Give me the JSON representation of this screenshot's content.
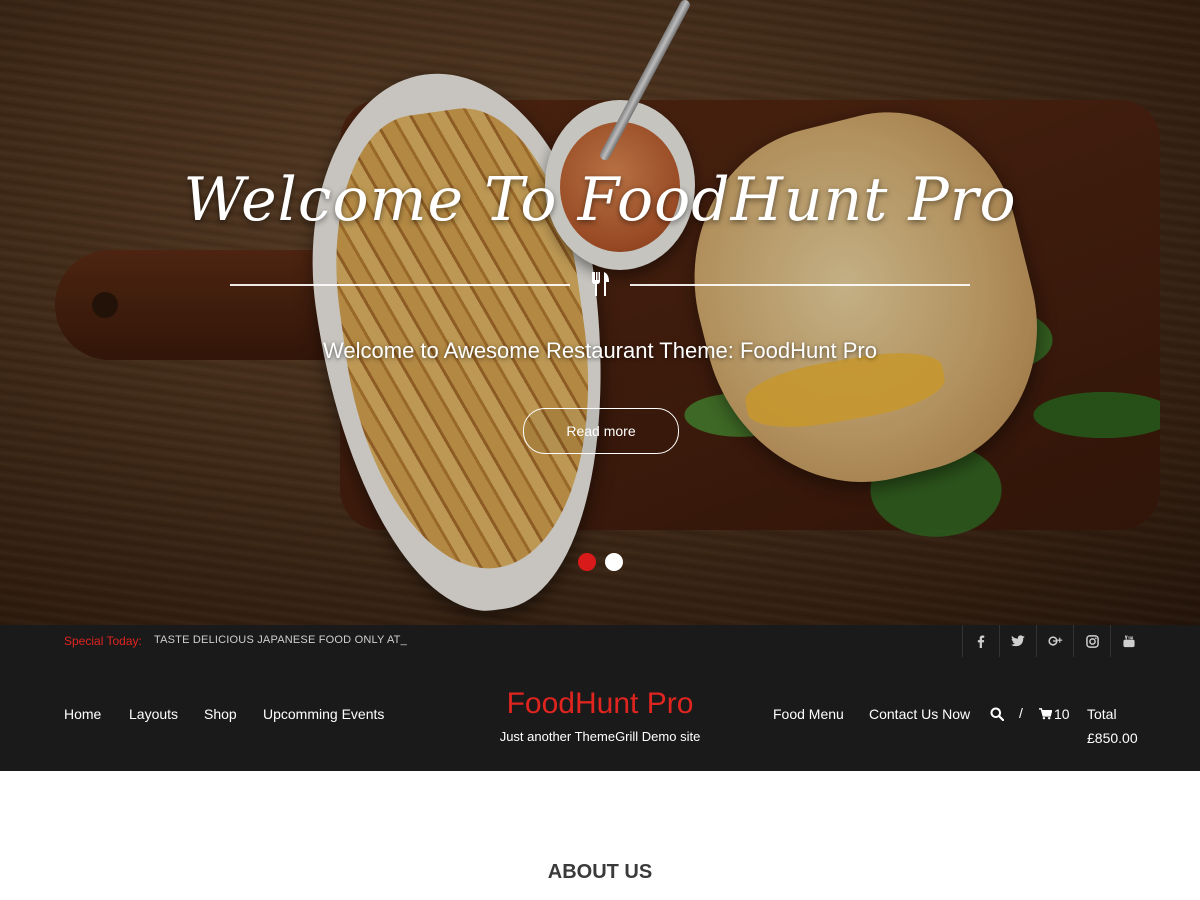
{
  "hero": {
    "title": "Welcome To FoodHunt Pro",
    "subtitle": "Welcome to Awesome Restaurant Theme: FoodHunt Pro",
    "read_more": "Read more",
    "slides": [
      {
        "active": true
      },
      {
        "active": false
      }
    ]
  },
  "topbar": {
    "special_label": "Special Today:",
    "special_text": "TASTE DELICIOUS JAPANESE FOOD ONLY AT_",
    "social": [
      "facebook-icon",
      "twitter-icon",
      "google-plus-icon",
      "instagram-icon",
      "youtube-icon"
    ]
  },
  "nav": {
    "left": [
      "Home",
      "Layouts",
      "Shop",
      "Upcomming Events"
    ],
    "brand": "FoodHunt Pro",
    "tagline": "Just another ThemeGrill Demo site",
    "right": [
      "Food Menu",
      "Contact Us Now"
    ],
    "separator": "/",
    "cart_count": "10",
    "total_label": "Total",
    "total_value": "£850.00"
  },
  "about": {
    "title": "ABOUT US"
  },
  "colors": {
    "accent": "#e0241f",
    "dark": "#1a1a1a"
  }
}
